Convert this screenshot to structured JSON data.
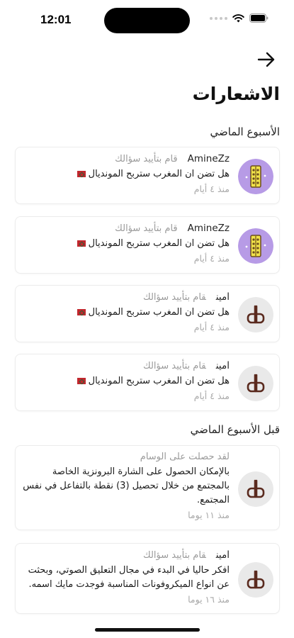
{
  "status_bar": {
    "time": "12:01"
  },
  "header": {
    "title": "الاشعارات"
  },
  "sections": {
    "last_week": "الأسبوع الماضي",
    "before_last_week": "قبل الأسبوع الماضي"
  },
  "notifications": [
    {
      "username": "AmineZz",
      "action": "قام بتأييد سؤالك",
      "body": "هل تضن ان المغرب ستربح المونديال",
      "time": "منذ ٤ أيام",
      "avatar": "purple-abacus"
    },
    {
      "username": "AmineZz",
      "action": "قام بتأييد سؤالك",
      "body": "هل تضن ان المغرب ستربح المونديال",
      "time": "منذ ٤ أيام",
      "avatar": "purple-abacus"
    },
    {
      "username": "امين",
      "action": "قام بتأييد سؤالك",
      "body": "هل تضن ان المغرب ستربح المونديال",
      "time": "منذ ٤ أيام",
      "avatar": "brand-logo"
    },
    {
      "username": "امين",
      "action": "قام بتأييد سؤالك",
      "body": "هل تضن ان المغرب ستربح المونديال",
      "time": "منذ ٤ أيام",
      "avatar": "brand-logo"
    },
    {
      "username": "",
      "action": "لقد حصلت على الوسام",
      "body": "بالإمكان الحصول على الشارة البرونزية الخاصة بالمجتمع من خلال تحصيل (3) نقطة بالتفاعل في نفس المجتمع.",
      "time": "منذ ١١ يوما",
      "avatar": "brand-logo"
    },
    {
      "username": "امين",
      "action": "قام بتأييد سؤالك",
      "body": "افكر حاليا في البدء في مجال التعليق الصوتي، وبحثت عن انواع الميكروفونات المناسبة فوجدت مايك اسمه.",
      "time": "منذ ١٦ يوما",
      "avatar": "brand-logo"
    }
  ],
  "colors": {
    "brand_brown": "#5a2a1e",
    "avatar_purple": "#b79be6",
    "flag_red": "#c1272d"
  }
}
